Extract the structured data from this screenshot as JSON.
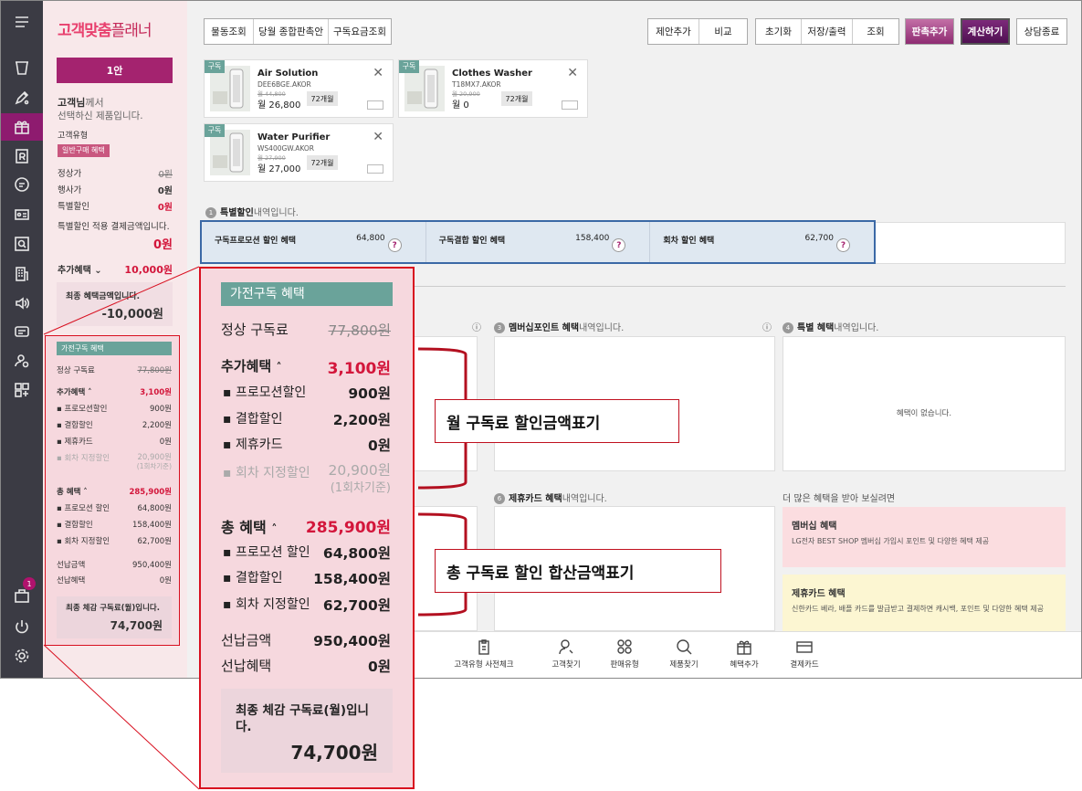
{
  "brand": {
    "main": "고객맞춤",
    "sub": "플래너"
  },
  "rail": [
    {
      "name": "menu-icon"
    },
    {
      "name": "cup-icon"
    },
    {
      "name": "pen-icon"
    },
    {
      "name": "gift-icon"
    },
    {
      "name": "r-card-icon"
    },
    {
      "name": "chat-icon"
    },
    {
      "name": "id-card-icon"
    },
    {
      "name": "search-box-icon"
    },
    {
      "name": "building-icon"
    },
    {
      "name": "speaker-icon"
    },
    {
      "name": "tag-icon"
    },
    {
      "name": "user-settings-icon"
    },
    {
      "name": "grid-plus-icon"
    }
  ],
  "rail_bottom": {
    "badge": "1"
  },
  "sidebar": {
    "qty": "1안",
    "customer_name": "고객님",
    "customer_suffix": "께서",
    "customer_line2": "선택하신 제품입니다.",
    "customer_type_label": "고객유형",
    "customer_type_tag": "일반구매 혜택",
    "rows": [
      {
        "label": "정상가",
        "value": "0원"
      },
      {
        "label": "행사가",
        "value": "0원"
      },
      {
        "label": "특별할인",
        "value": "0원"
      }
    ],
    "special_line": "특별할인 적용 결제금액입니다.",
    "special_value": "0원",
    "extra_label": "추가혜택",
    "extra_value": "10,000원",
    "final_label": "최종 혜택금액입니다.",
    "final_value": "-10,000원"
  },
  "detail": {
    "tag": "가전구독 혜택",
    "normal_label": "정상 구독료",
    "normal_value": "77,800원",
    "extra_label": "추가혜택",
    "extra_value": "3,100원",
    "extra_items": [
      {
        "label": "프로모션할인",
        "value": "900원"
      },
      {
        "label": "결합할인",
        "value": "2,200원"
      },
      {
        "label": "제휴카드",
        "value": "0원"
      }
    ],
    "installment_label": "회차 지정할인",
    "installment_value": "20,900원",
    "installment_note": "(1회차기준)",
    "total_label": "총 혜택",
    "total_value": "285,900원",
    "total_items": [
      {
        "label": "프로모션 할인",
        "value": "64,800원"
      },
      {
        "label": "결합할인",
        "value": "158,400원"
      },
      {
        "label": "회차 지정할인",
        "value": "62,700원"
      }
    ],
    "prepay_label": "선납금액",
    "prepay_value": "950,400원",
    "prepay_benefit_label": "선납혜택",
    "prepay_benefit_value": "0원",
    "final_label": "최종 체감 구독료(월)입니다.",
    "final_value": "74,700원"
  },
  "zoom": {
    "tag": "가전구독 혜택",
    "normal_label": "정상 구독료",
    "normal_value": "77,800원",
    "extra_label": "추가혜택",
    "extra_value": "3,100원",
    "extra_items": [
      {
        "label": "프로모션할인",
        "value": "900원"
      },
      {
        "label": "결합할인",
        "value": "2,200원"
      },
      {
        "label": "제휴카드",
        "value": "0원"
      }
    ],
    "installment_label": "회차 지정할인",
    "installment_value": "20,900원",
    "installment_note": "(1회차기준)",
    "total_label": "총 혜택",
    "total_value": "285,900원",
    "total_items": [
      {
        "label": "프로모션 할인",
        "value": "64,800원"
      },
      {
        "label": "결합할인",
        "value": "158,400원"
      },
      {
        "label": "회차 지정할인",
        "value": "62,700원"
      }
    ],
    "prepay_label": "선납금액",
    "prepay_value": "950,400원",
    "prepay_benefit_label": "선납혜택",
    "prepay_benefit_value": "0원",
    "final_label_1": "최종 체감 구독료(월)입니",
    "final_label_2": "다.",
    "final_value": "74,700원"
  },
  "toolbar": {
    "left": [
      "물동조회",
      "당월 종합판촉안",
      "구독요금조회"
    ],
    "group1": [
      "제안추가",
      "비교"
    ],
    "group2": [
      "초기화",
      "저장/출력",
      "조회"
    ],
    "promo_add": "판촉추가",
    "calculate": "계산하기",
    "end": "상담종료"
  },
  "products": [
    {
      "sub": "구독",
      "name": "Air Solution",
      "model": "DEE6BGE.AKOR",
      "old": "월 44,800",
      "price": "월 26,800",
      "months": "72개월"
    },
    {
      "sub": "구독",
      "name": "Clothes Washer",
      "model": "T18MX7.AKOR",
      "old": "월 20,900",
      "price": "월 0",
      "months": "72개월"
    },
    {
      "sub": "구독",
      "name": "Water Purifier",
      "model": "WS400GW.AKOR",
      "old": "월 27,900",
      "price": "월 27,000",
      "months": "72개월"
    }
  ],
  "special": {
    "num": "1",
    "title_b": "특별할인",
    "title_rest": "내역입니다.",
    "cells": [
      {
        "label": "구독프로모션 할인 혜택",
        "value": "64,800"
      },
      {
        "label": "구독결합 할인 혜택",
        "value": "158,400"
      },
      {
        "label": "회차 할인 혜택",
        "value": "62,700"
      }
    ],
    "q": "?"
  },
  "sections": {
    "s3": {
      "num": "3",
      "b": "멤버십포인트 혜택",
      "rest": "내역입니다."
    },
    "s4": {
      "num": "4",
      "b": "특별 혜택",
      "rest": "내역입니다."
    },
    "s6": {
      "num": "6",
      "b": "제휴카드 혜택",
      "rest": "내역입니다."
    },
    "no_benefit": "혜택이 없습니다.",
    "more": "더 많은 혜택을 받아 보실려면",
    "q": "?"
  },
  "promos": [
    {
      "title": "멤버십 혜택",
      "desc": "LG전자 BEST SHOP 멤버십 가입시 포인트 및 다양한 혜택 제공",
      "color": "#fbdde0"
    },
    {
      "title": "제휴카드 혜택",
      "desc": "신한카드 베라, 배플 카드를 발급받고 결제하면 캐시백, 포인트 및 다양한 혜택 제공",
      "color": "#fcf6d2"
    }
  ],
  "bottom_bar": [
    {
      "label": "고객유형 사전체크",
      "icon": "clipboard-icon"
    },
    {
      "label": "고객찾기",
      "icon": "user-search-icon"
    },
    {
      "label": "판매유형",
      "icon": "circles-icon"
    },
    {
      "label": "제품찾기",
      "icon": "magnifier-icon"
    },
    {
      "label": "혜택추가",
      "icon": "gift-icon"
    },
    {
      "label": "결제카드",
      "icon": "card-icon"
    }
  ],
  "callouts": {
    "monthly": "월 구독료 할인금액표기",
    "total": "총 구독료 할인 합산금액표기"
  },
  "colors": {
    "accent": "#a4236f",
    "red": "#d3163b",
    "teal": "#6aa39a",
    "blue": "#3b69a6"
  }
}
